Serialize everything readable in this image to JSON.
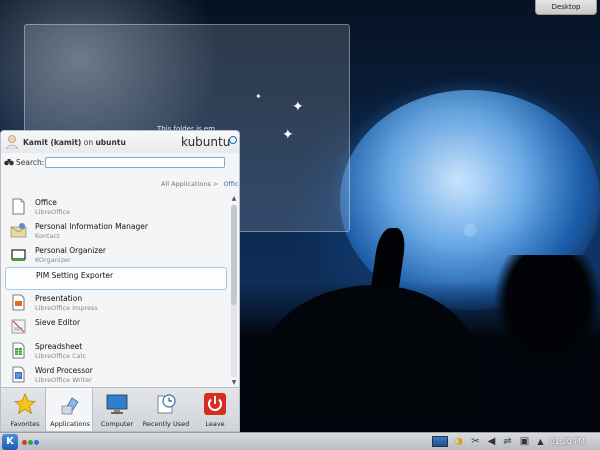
{
  "desktop": {
    "button_label": "Desktop",
    "folder_view_text": "This folder is em"
  },
  "launcher": {
    "user": {
      "display": "Kamit (kamit)",
      "on": "on",
      "host": "ubuntu"
    },
    "brand": "kubuntu",
    "search": {
      "label": "Search:",
      "value": "",
      "placeholder": ""
    },
    "breadcrumb": {
      "root": "All Applications",
      "sep": ">",
      "current": "Office"
    },
    "apps": [
      {
        "name": "Office",
        "sub": "LibreOffice",
        "icon": "libreoffice-doc-icon"
      },
      {
        "name": "Personal Information Manager",
        "sub": "Kontact",
        "icon": "kontact-icon"
      },
      {
        "name": "Personal Organizer",
        "sub": "KOrganizer",
        "icon": "korganizer-icon"
      },
      {
        "name": "PIM Setting Exporter",
        "sub": "",
        "icon": ""
      },
      {
        "name": "Presentation",
        "sub": "LibreOffice Impress",
        "icon": "impress-icon"
      },
      {
        "name": "Sieve Editor",
        "sub": "",
        "icon": "sieve-editor-icon"
      },
      {
        "name": "Spreadsheet",
        "sub": "LibreOffice Calc",
        "icon": "calc-icon"
      },
      {
        "name": "Word Processor",
        "sub": "LibreOffice Writer",
        "icon": "writer-icon"
      }
    ],
    "tabs": [
      {
        "label": "Favorites",
        "icon": "star-icon"
      },
      {
        "label": "Applications",
        "icon": "applications-icon"
      },
      {
        "label": "Computer",
        "icon": "computer-icon"
      },
      {
        "label": "Recently Used",
        "icon": "clock-icon"
      },
      {
        "label": "Leave",
        "icon": "power-icon"
      }
    ],
    "active_tab": "Applications"
  },
  "taskbar": {
    "start_glyph": "K",
    "clock": "01:20 PM",
    "tray": [
      "window-icon",
      "klipper-icon",
      "scissors-icon",
      "volume-icon",
      "usb-icon",
      "network-icon",
      "chevron-up-icon"
    ]
  },
  "colors": {
    "accent": "#3a6ab0",
    "brand_circle": "#1b6fc2",
    "taskbar_dot_red": "#d43b3b",
    "taskbar_dot_green": "#3aa53a",
    "taskbar_dot_blue": "#3a6fd4"
  }
}
